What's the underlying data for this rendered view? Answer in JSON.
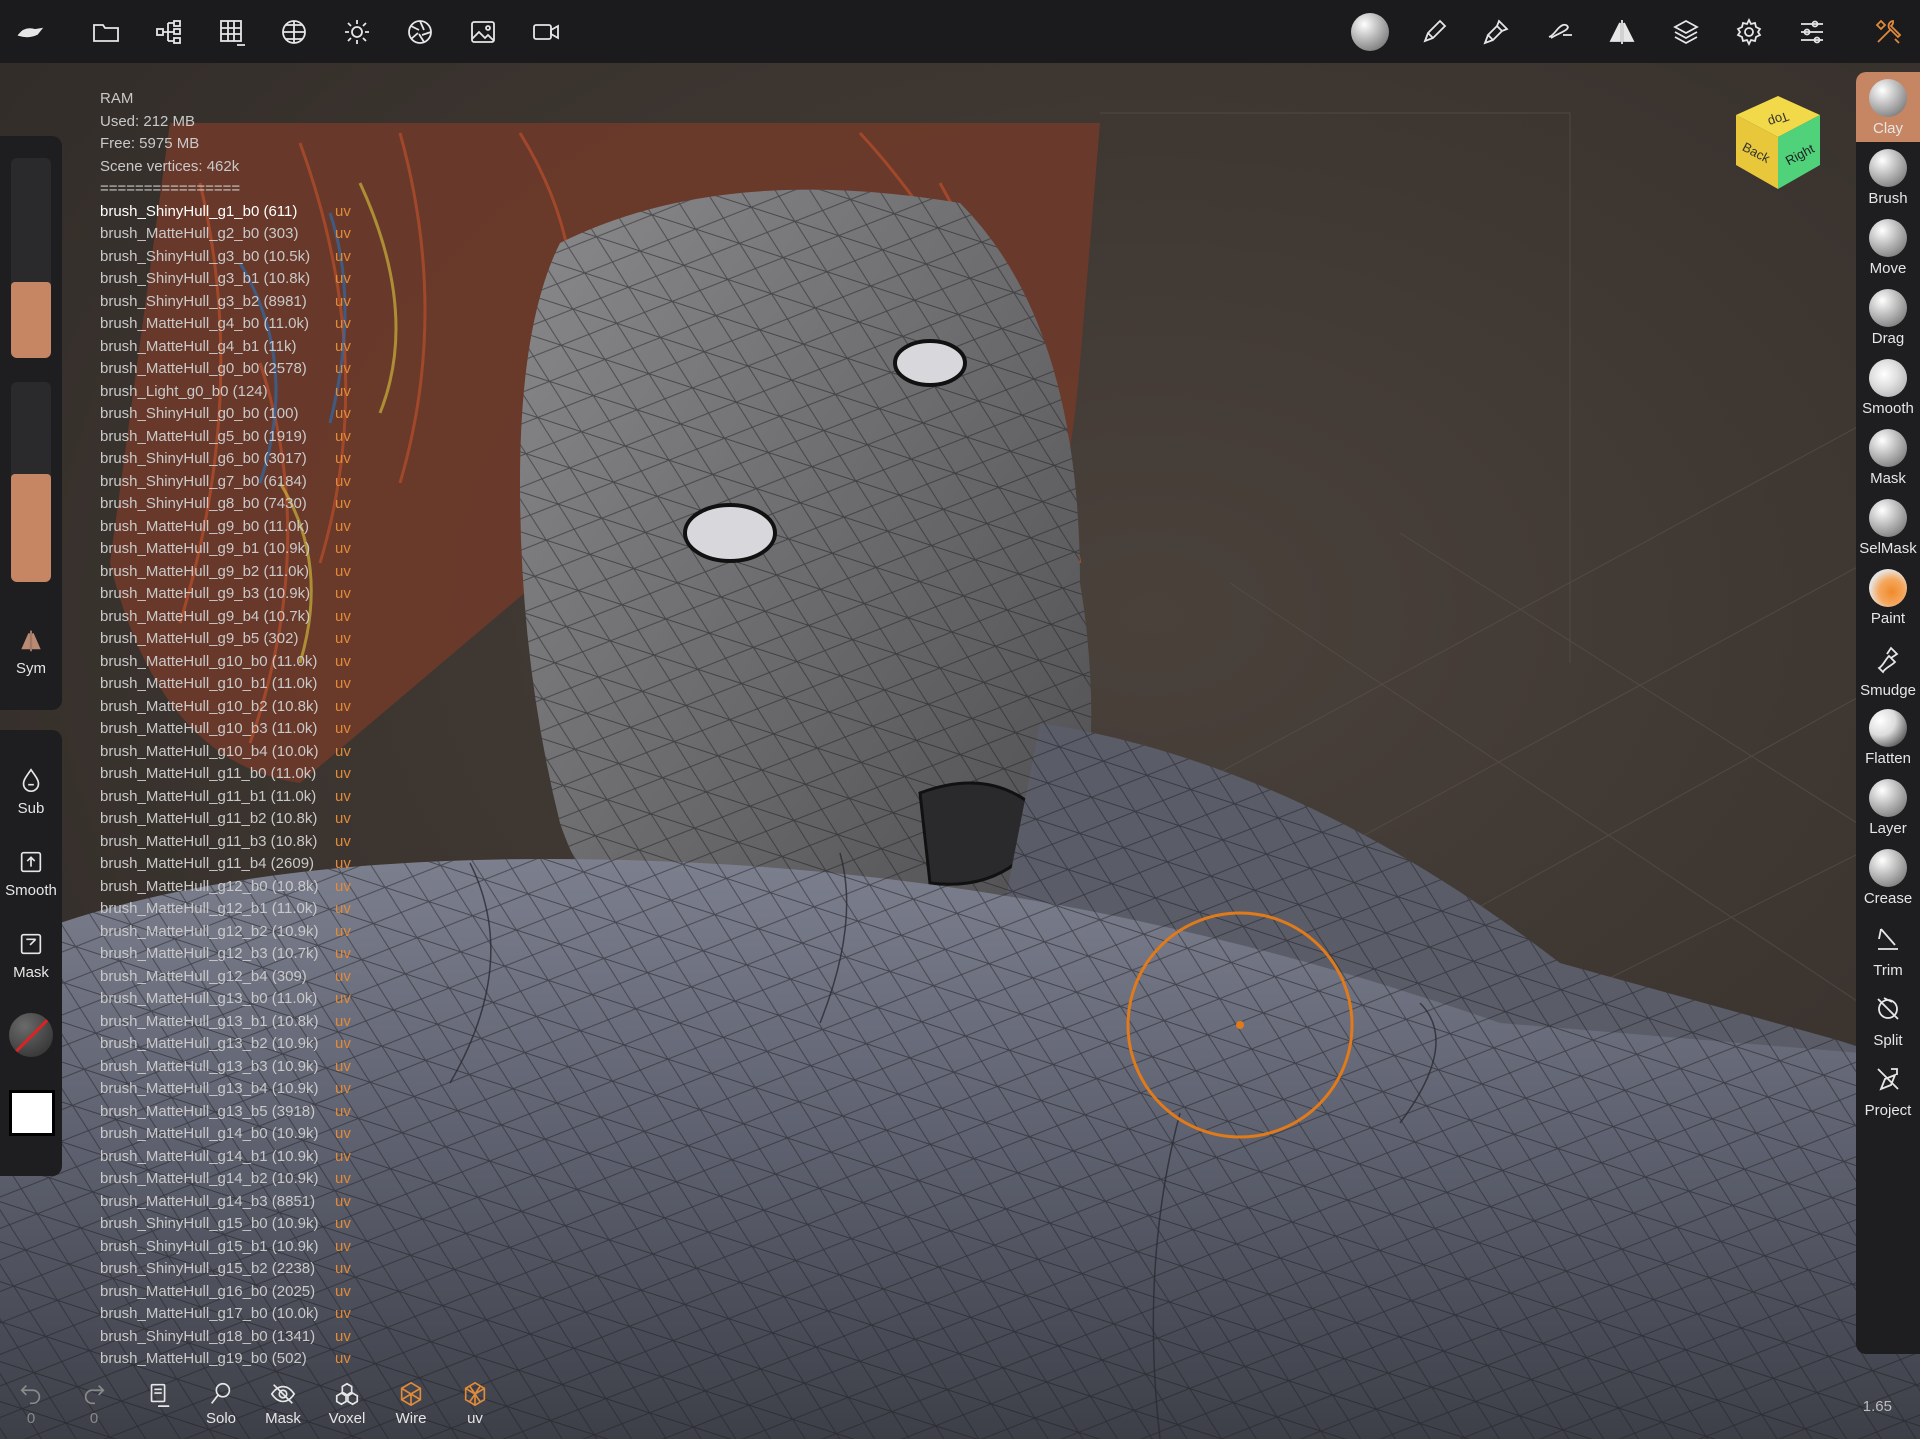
{
  "topbar": {
    "icons": [
      "app-logo-icon",
      "folder-icon",
      "scene-tree-icon",
      "grid-icon",
      "material-sphere-icon",
      "light-sun-icon",
      "camera-aperture-icon",
      "image-icon",
      "video-camera-icon",
      "matcap-ball-icon",
      "brush-pen-icon",
      "paint-brush-icon",
      "stroke-icon",
      "symmetry-icon",
      "layers-icon",
      "settings-gear-icon",
      "sliders-icon",
      "tools-icon"
    ]
  },
  "stats": {
    "ram_label": "RAM",
    "used": "Used: 212 MB",
    "free": "Free: 5975 MB",
    "vertices": "Scene vertices: 462k",
    "separator": "================",
    "uv_tag": "uv",
    "meshes": [
      "brush_ShinyHull_g1_b0 (611)",
      "brush_MatteHull_g2_b0 (303)",
      "brush_ShinyHull_g3_b0 (10.5k)",
      "brush_ShinyHull_g3_b1 (10.8k)",
      "brush_ShinyHull_g3_b2 (8981)",
      "brush_MatteHull_g4_b0 (11.0k)",
      "brush_MatteHull_g4_b1 (11k)",
      "brush_MatteHull_g0_b0 (2578)",
      "brush_Light_g0_b0 (124)",
      "brush_ShinyHull_g0_b0 (100)",
      "brush_MatteHull_g5_b0 (1919)",
      "brush_ShinyHull_g6_b0 (3017)",
      "brush_ShinyHull_g7_b0 (6184)",
      "brush_ShinyHull_g8_b0 (7430)",
      "brush_MatteHull_g9_b0 (11.0k)",
      "brush_MatteHull_g9_b1 (10.9k)",
      "brush_MatteHull_g9_b2 (11.0k)",
      "brush_MatteHull_g9_b3 (10.9k)",
      "brush_MatteHull_g9_b4 (10.7k)",
      "brush_MatteHull_g9_b5 (302)",
      "brush_MatteHull_g10_b0 (11.0k)",
      "brush_MatteHull_g10_b1 (11.0k)",
      "brush_MatteHull_g10_b2 (10.8k)",
      "brush_MatteHull_g10_b3 (11.0k)",
      "brush_MatteHull_g10_b4 (10.0k)",
      "brush_MatteHull_g11_b0 (11.0k)",
      "brush_MatteHull_g11_b1 (11.0k)",
      "brush_MatteHull_g11_b2 (10.8k)",
      "brush_MatteHull_g11_b3 (10.8k)",
      "brush_MatteHull_g11_b4 (2609)",
      "brush_MatteHull_g12_b0 (10.8k)",
      "brush_MatteHull_g12_b1 (11.0k)",
      "brush_MatteHull_g12_b2 (10.9k)",
      "brush_MatteHull_g12_b3 (10.7k)",
      "brush_MatteHull_g12_b4 (309)",
      "brush_MatteHull_g13_b0 (11.0k)",
      "brush_MatteHull_g13_b1 (10.8k)",
      "brush_MatteHull_g13_b2 (10.9k)",
      "brush_MatteHull_g13_b3 (10.9k)",
      "brush_MatteHull_g13_b4 (10.9k)",
      "brush_MatteHull_g13_b5 (3918)",
      "brush_MatteHull_g14_b0 (10.9k)",
      "brush_MatteHull_g14_b1 (10.9k)",
      "brush_MatteHull_g14_b2 (10.9k)",
      "brush_MatteHull_g14_b3 (8851)",
      "brush_ShinyHull_g15_b0 (10.9k)",
      "brush_ShinyHull_g15_b1 (10.9k)",
      "brush_ShinyHull_g15_b2 (2238)",
      "brush_MatteHull_g16_b0 (2025)",
      "brush_MatteHull_g17_b0 (10.0k)",
      "brush_ShinyHull_g18_b0 (1341)",
      "brush_MatteHull_g19_b0 (502)"
    ]
  },
  "left": {
    "slider1_fill": 0.38,
    "slider2_fill": 0.54,
    "sym_label": "Sym",
    "sub_label": "Sub",
    "smooth_label": "Smooth",
    "mask_label": "Mask",
    "color_swatch": "#ffffff"
  },
  "view_cube": {
    "top": "Top",
    "back": "Back",
    "right": "Right"
  },
  "tools": [
    {
      "label": "Clay",
      "icon": "clay-ball-icon",
      "active": true
    },
    {
      "label": "Brush",
      "icon": "brush-ball-icon"
    },
    {
      "label": "Move",
      "icon": "move-ball-icon"
    },
    {
      "label": "Drag",
      "icon": "drag-ball-icon"
    },
    {
      "label": "Smooth",
      "icon": "smooth-ball-icon"
    },
    {
      "label": "Mask",
      "icon": "mask-ball-icon"
    },
    {
      "label": "SelMask",
      "icon": "selmask-ball-icon"
    },
    {
      "label": "Paint",
      "icon": "paint-ball-icon"
    },
    {
      "label": "Smudge",
      "icon": "smudge-icon"
    },
    {
      "label": "Flatten",
      "icon": "flatten-ball-icon"
    },
    {
      "label": "Layer",
      "icon": "layer-ball-icon"
    },
    {
      "label": "Crease",
      "icon": "crease-ball-icon"
    },
    {
      "label": "Trim",
      "icon": "trim-icon"
    },
    {
      "label": "Split",
      "icon": "split-icon"
    },
    {
      "label": "Project",
      "icon": "project-icon"
    }
  ],
  "bottom": {
    "undo_count": "0",
    "redo_count": "0",
    "solo": "Solo",
    "mask": "Mask",
    "voxel": "Voxel",
    "wire": "Wire",
    "uv": "uv"
  },
  "zoom": "1.65",
  "colors": {
    "accent": "#c68563",
    "uv": "#e08a3a",
    "brush_ring": "#e07a1a"
  }
}
